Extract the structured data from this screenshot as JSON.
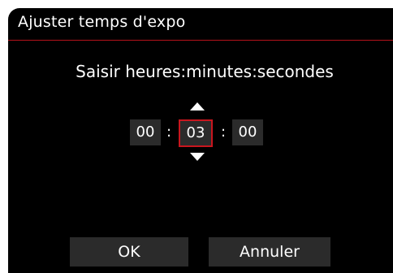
{
  "title": "Ajuster temps d'expo",
  "instruction": "Saisir heures:minutes:secondes",
  "time": {
    "hours": "00",
    "minutes": "03",
    "seconds": "00",
    "separator": ":"
  },
  "buttons": {
    "ok": "OK",
    "cancel": "Annuler"
  },
  "colors": {
    "background": "#000000",
    "accent": "#c8161e",
    "field": "#2b2b2b",
    "text": "#ffffff"
  },
  "selected_field": "minutes"
}
